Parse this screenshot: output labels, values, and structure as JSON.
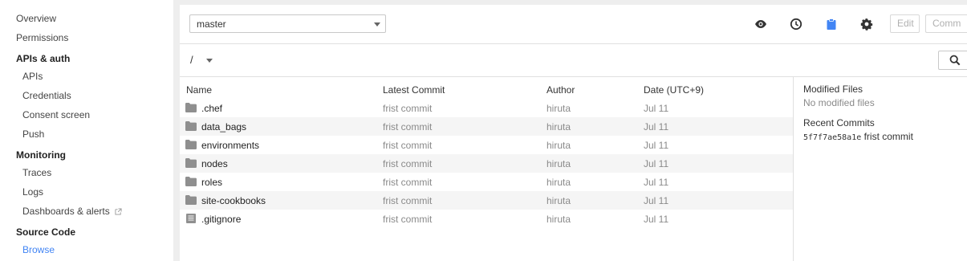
{
  "sidebar": {
    "overview": "Overview",
    "permissions": "Permissions",
    "apis_auth": "APIs & auth",
    "apis": "APIs",
    "credentials": "Credentials",
    "consent_screen": "Consent screen",
    "push": "Push",
    "monitoring": "Monitoring",
    "traces": "Traces",
    "logs": "Logs",
    "dashboards_alerts": "Dashboards & alerts",
    "source_code": "Source Code",
    "browse": "Browse"
  },
  "toolbar": {
    "branch": "master",
    "icons": [
      "eye-icon",
      "history-icon",
      "clipboard-icon",
      "gear-icon"
    ],
    "edit_label": "Edit",
    "commit_label": "Comm"
  },
  "path": {
    "root": "/"
  },
  "table": {
    "headers": {
      "name": "Name",
      "latest_commit": "Latest Commit",
      "author": "Author",
      "date": "Date (UTC+9)"
    },
    "rows": [
      {
        "name": ".chef",
        "type": "folder",
        "commit": "frist commit",
        "author": "hiruta",
        "date": "Jul 11"
      },
      {
        "name": "data_bags",
        "type": "folder",
        "commit": "frist commit",
        "author": "hiruta",
        "date": "Jul 11"
      },
      {
        "name": "environments",
        "type": "folder",
        "commit": "frist commit",
        "author": "hiruta",
        "date": "Jul 11"
      },
      {
        "name": "nodes",
        "type": "folder",
        "commit": "frist commit",
        "author": "hiruta",
        "date": "Jul 11"
      },
      {
        "name": "roles",
        "type": "folder",
        "commit": "frist commit",
        "author": "hiruta",
        "date": "Jul 11"
      },
      {
        "name": "site-cookbooks",
        "type": "folder",
        "commit": "frist commit",
        "author": "hiruta",
        "date": "Jul 11"
      },
      {
        "name": ".gitignore",
        "type": "file",
        "commit": "frist commit",
        "author": "hiruta",
        "date": "Jul 11"
      }
    ]
  },
  "right_panel": {
    "modified_title": "Modified Files",
    "modified_empty": "No modified files",
    "recent_title": "Recent Commits",
    "recent_hash": "5f7f7ae58a1e",
    "recent_message": "frist commit"
  },
  "colors": {
    "accent": "#4285f4",
    "background": "#eeeeee",
    "muted_text": "#8a8a8a"
  }
}
